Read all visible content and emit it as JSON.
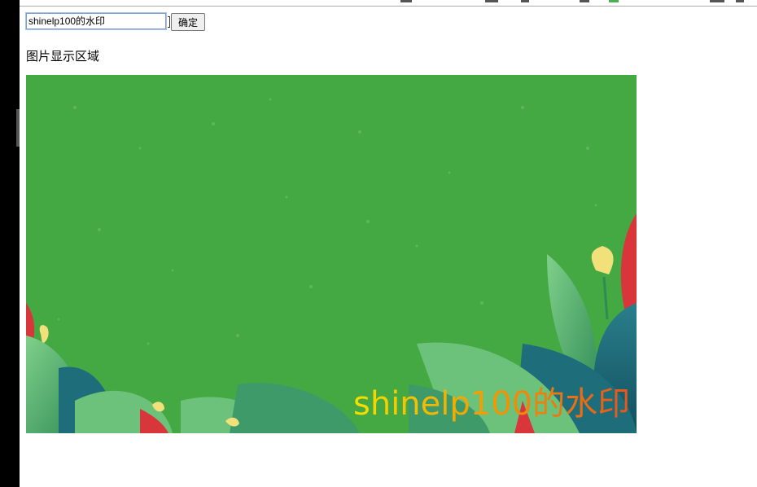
{
  "watermark_form": {
    "input_value": "shinelp100的水印",
    "confirm_label": "确定"
  },
  "image_area": {
    "title": "图片显示区域",
    "watermark_text": "shinelp100的水印",
    "colors": {
      "background_green": "#44a843",
      "leaf_dark": "#1d6e7a",
      "leaf_light": "#6cc27a",
      "flower_red": "#d9363b",
      "flower_yellow": "#f2e07a"
    }
  }
}
